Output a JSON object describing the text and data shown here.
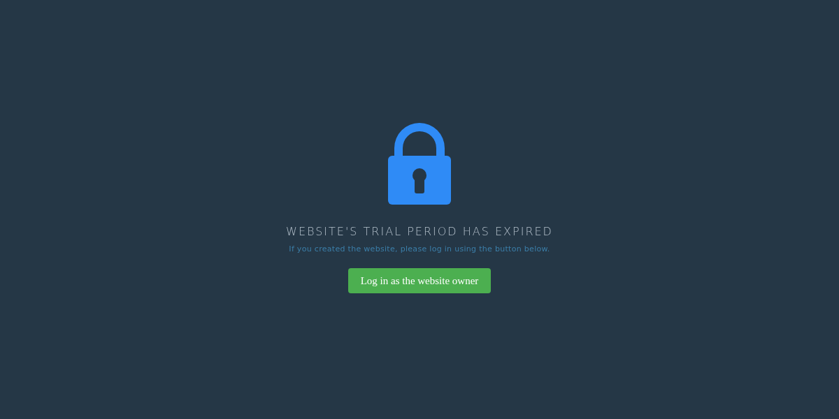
{
  "title": "WEBSITE'S TRIAL PERIOD HAS EXPIRED",
  "message": "If you created the website, please log in using the button below.",
  "button": {
    "label": "Log in as the website owner"
  }
}
